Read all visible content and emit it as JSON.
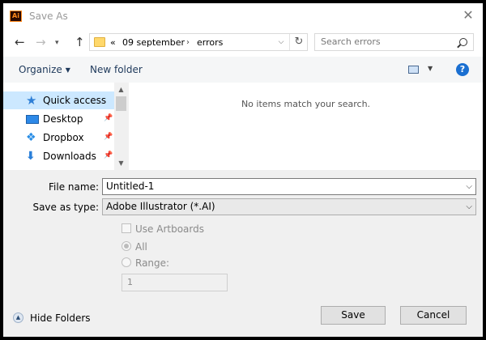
{
  "window": {
    "app_icon_text": "Ai",
    "title": "Save As",
    "close_glyph": "✕"
  },
  "nav": {
    "back_glyph": "←",
    "forward_glyph": "→",
    "recent_glyph": "▾",
    "up_glyph": "↑",
    "breadcrumb": {
      "overflow": "«",
      "segments": [
        "09 september",
        "errors"
      ],
      "separator": "›"
    },
    "address_dropdown_glyph": "⌵",
    "refresh_glyph": "↻",
    "search_placeholder": "Search errors"
  },
  "toolbar": {
    "organize_label": "Organize",
    "caret": "▼",
    "new_folder_label": "New folder",
    "view_drop_glyph": "▼",
    "help_glyph": "?"
  },
  "nav_pane": {
    "items": [
      {
        "label": "Quick access",
        "icon": "star-icon",
        "glyph": "★",
        "selected": true,
        "pinned": false
      },
      {
        "label": "Desktop",
        "icon": "desktop-icon",
        "glyph": "",
        "selected": false,
        "pinned": true
      },
      {
        "label": "Dropbox",
        "icon": "dropbox-icon",
        "glyph": "❖",
        "selected": false,
        "pinned": true
      },
      {
        "label": "Downloads",
        "icon": "download-icon",
        "glyph": "⬇",
        "selected": false,
        "pinned": true
      }
    ],
    "pin_glyph": "📌",
    "scroll_up_glyph": "▲",
    "scroll_down_glyph": "▼"
  },
  "file_view": {
    "empty_message": "No items match your search."
  },
  "form": {
    "file_name_label": "File name:",
    "file_name_value": "Untitled-1",
    "save_as_type_label": "Save as type:",
    "save_as_type_value": "Adobe Illustrator (*.AI)",
    "dropdown_glyph": "⌵"
  },
  "options": {
    "use_artboards_label": "Use Artboards",
    "use_artboards_checked": false,
    "all_label": "All",
    "all_selected": true,
    "range_label": "Range:",
    "range_value": "1"
  },
  "footer": {
    "hide_folders_label": "Hide Folders",
    "hide_folders_glyph": "▲",
    "save_label": "Save",
    "cancel_label": "Cancel"
  },
  "colors": {
    "selection": "#cce8ff",
    "accent": "#1a6fd1",
    "app_icon": "#ff8a1c"
  }
}
